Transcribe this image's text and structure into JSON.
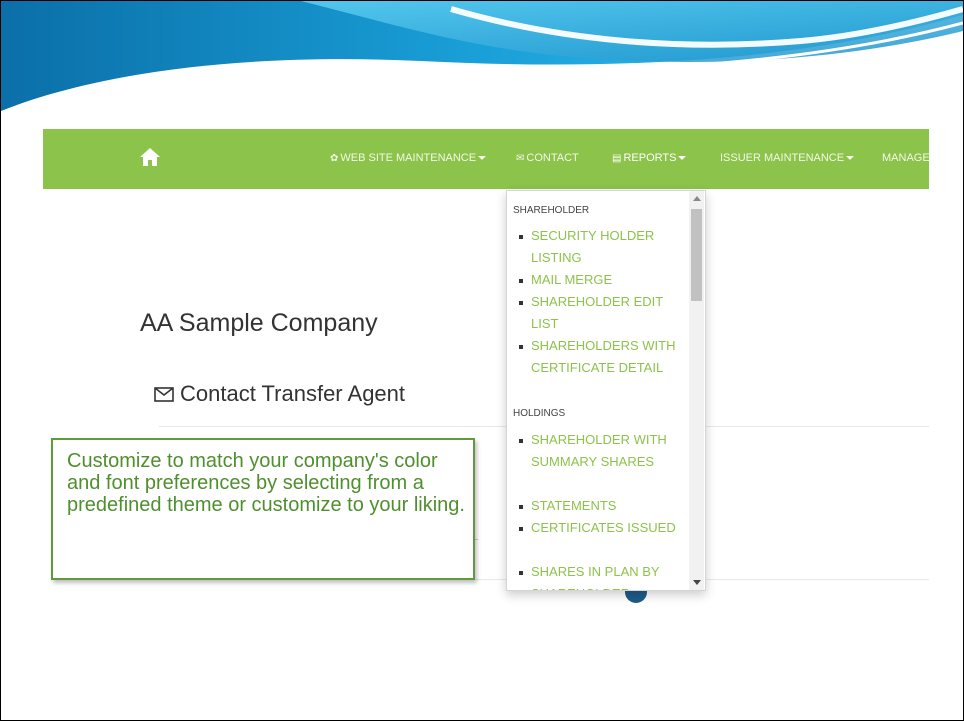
{
  "nav": {
    "items": [
      {
        "label": "WEB SITE MAINTENANCE",
        "icon": "gear-icon",
        "glyph": "✿",
        "caret": true
      },
      {
        "label": "CONTACT",
        "icon": "envelope-icon",
        "glyph": "✉",
        "caret": false
      },
      {
        "label": "REPORTS",
        "icon": "file-icon",
        "glyph": "▤",
        "caret": true
      },
      {
        "label": "ISSUER MAINTENANCE",
        "icon": "",
        "glyph": "",
        "caret": true
      },
      {
        "label": "MANAGE",
        "icon": "",
        "glyph": "",
        "caret": false
      }
    ],
    "bg_color": "#8cc34a"
  },
  "main": {
    "company_title": "AA Sample Company",
    "contact_heading": "Contact Transfer Agent"
  },
  "callout": {
    "text": "Customize to match your company's color and font preferences by selecting from a predefined theme or customize to your liking.",
    "border_color": "#5f9a3d",
    "text_color": "#4f8f2e"
  },
  "reports_menu": {
    "sections": [
      {
        "header": "SHAREHOLDER",
        "items": [
          "SECURITY HOLDER LISTING",
          "MAIL MERGE",
          "SHAREHOLDER EDIT LIST",
          "SHAREHOLDERS WITH CERTIFICATE DETAIL"
        ]
      },
      {
        "header": "HOLDINGS",
        "items": [
          "SHAREHOLDER WITH SUMMARY SHARES",
          "STATEMENTS",
          "CERTIFICATES ISSUED",
          "SHARES IN PLAN BY SHAREHOLDER"
        ]
      }
    ],
    "link_color": "#8cc34a"
  }
}
